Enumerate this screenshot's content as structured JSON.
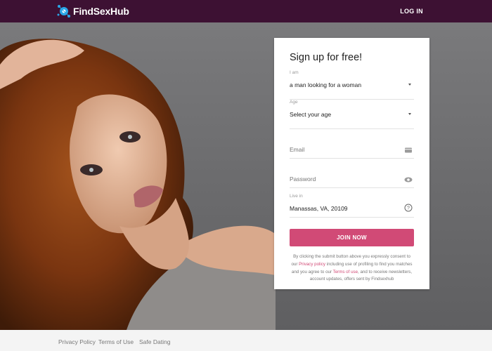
{
  "header": {
    "logo_text": "FindSexHub",
    "login_label": "LOG IN"
  },
  "signup": {
    "title": "Sign up for free!",
    "iam_label": "I am",
    "iam_value": "a man looking for a woman",
    "age_label": "Age",
    "age_value": "Select your age",
    "email_placeholder": "Email",
    "password_placeholder": "Password",
    "live_label": "Live in",
    "live_value": "Manassas, VA, 20109",
    "join_label": "JOIN NOW",
    "consent_1": "By clicking the submit button above you expressly consent to our",
    "privacy_link": "Privacy policy",
    "consent_2": "including use of profiling to find you matches and you agree to our",
    "terms_link": "Terms of use",
    "consent_3": ", and to receive newsletters, account updates, offers sent by Findsexhub"
  },
  "footer": {
    "links": [
      "Privacy Policy",
      "Terms of Use",
      "Safe Dating"
    ]
  },
  "colors": {
    "topbar": "#3d1133",
    "accent": "#d14a76",
    "footer": "#f4f4f4"
  },
  "icons": [
    "logo-mark-icon",
    "caret-down-icon",
    "email-card-icon",
    "eye-icon",
    "help-circle-icon"
  ]
}
